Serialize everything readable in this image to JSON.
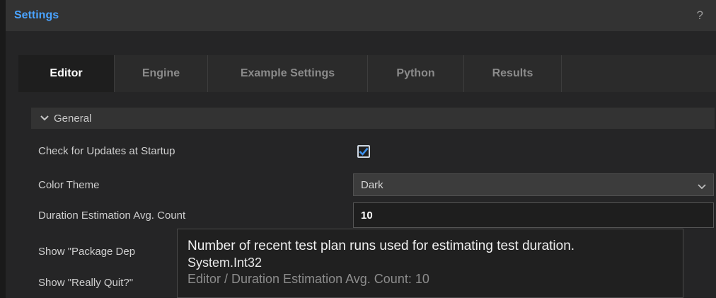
{
  "window": {
    "title": "Settings",
    "help_label": "?"
  },
  "tabs": [
    {
      "label": "Editor",
      "active": true
    },
    {
      "label": "Engine",
      "active": false
    },
    {
      "label": "Example Settings",
      "active": false
    },
    {
      "label": "Python",
      "active": false
    },
    {
      "label": "Results",
      "active": false
    }
  ],
  "section": {
    "title": "General",
    "icon": "chevron-down-icon"
  },
  "settings": {
    "check_updates": {
      "label": "Check for Updates at Startup",
      "checked": true
    },
    "color_theme": {
      "label": "Color Theme",
      "value": "Dark"
    },
    "duration_count": {
      "label": "Duration Estimation Avg. Count",
      "value": "10"
    },
    "show_package": {
      "label": "Show \"Package Dep"
    },
    "show_quit": {
      "label": "Show \"Really Quit?\""
    }
  },
  "tooltip": {
    "description": "Number of recent test plan runs used for estimating test duration.",
    "type": "System.Int32",
    "path": "Editor / Duration Estimation Avg. Count: 10"
  },
  "colors": {
    "accent": "#4aa3ff",
    "checkmark": "#3b8eea"
  }
}
